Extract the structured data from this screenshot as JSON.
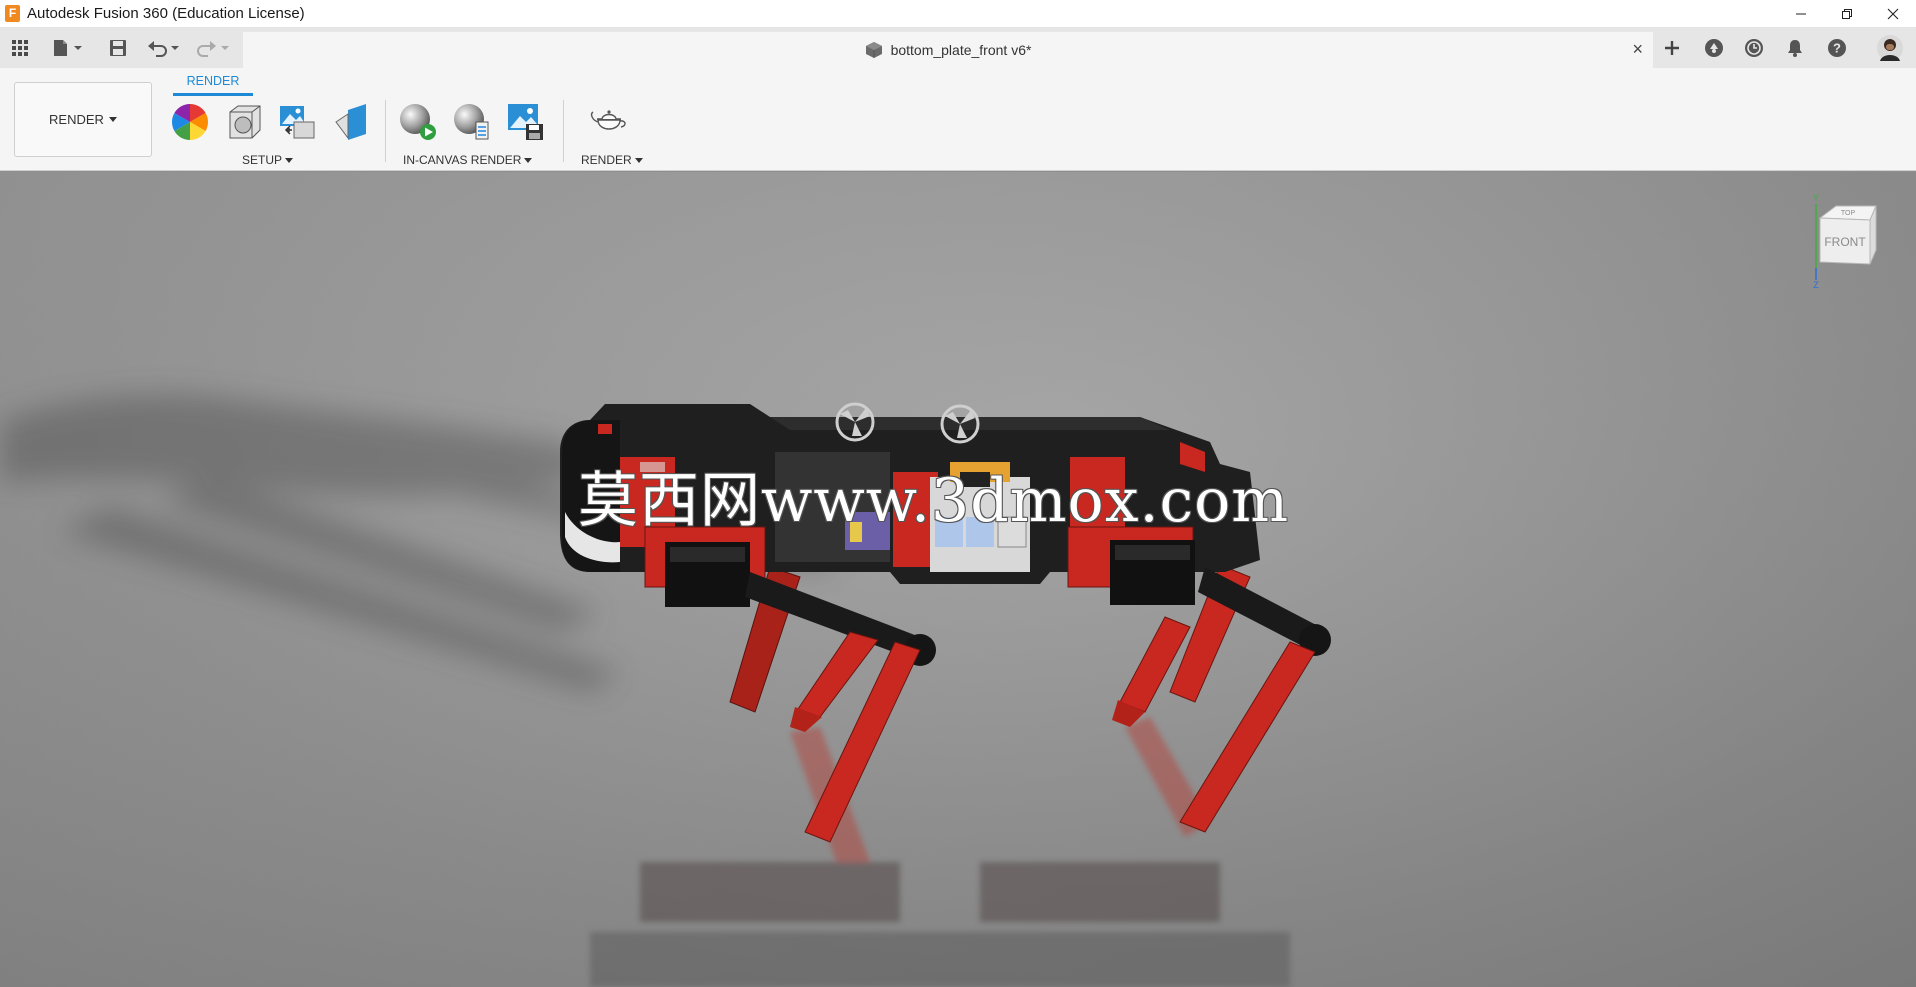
{
  "window": {
    "app_title": "Autodesk Fusion 360 (Education License)",
    "logo_letter": "F",
    "controls": [
      "minimize",
      "restore",
      "close"
    ]
  },
  "tabbar": {
    "doc_title": "bottom_plate_front v6*",
    "close_glyph": "×",
    "quick_access_icons": [
      "data-panel-grid-icon",
      "file-icon",
      "save-icon",
      "undo-icon",
      "redo-icon"
    ],
    "right_icons": [
      "new-tab-plus-icon",
      "extensions-icon",
      "job-status-icon",
      "notifications-bell-icon",
      "help-icon",
      "user-avatar"
    ]
  },
  "ribbon": {
    "workspace_label": "RENDER",
    "active_tab": "RENDER",
    "groups": [
      {
        "label": "SETUP",
        "tools": [
          "appearance-icon",
          "scene-settings-icon",
          "texture-map-icon",
          "decal-icon"
        ]
      },
      {
        "label": "IN-CANVAS RENDER",
        "tools": [
          "in-canvas-render-icon",
          "in-canvas-render-settings-icon",
          "capture-image-icon"
        ]
      },
      {
        "label": "RENDER",
        "tools": [
          "render-teapot-icon"
        ]
      }
    ]
  },
  "viewcube": {
    "front_label": "FRONT",
    "top_label": "TOP",
    "axis_y": "Y",
    "axis_z": "Z"
  },
  "watermark": "莫西网www.3dmox.com",
  "colors": {
    "accent": "#1e8ad6",
    "robot_red": "#c8281f",
    "robot_black": "#1f1f1f",
    "canvas_grey": "#9a9a9a"
  }
}
